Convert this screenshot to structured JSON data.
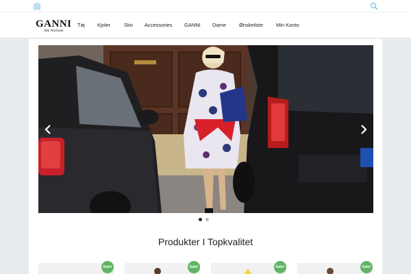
{
  "topbar": {
    "cart_icon": "shopping-bag-icon",
    "search_icon": "search-icon"
  },
  "header": {
    "logo": {
      "name": "GANNI",
      "sub": "Akk Narbads"
    },
    "nav": [
      {
        "label": "Tøj"
      },
      {
        "label": "Kjoler"
      },
      {
        "label": "Sko"
      },
      {
        "label": "Accessories"
      },
      {
        "label": "GANNI"
      },
      {
        "label": "Dame"
      },
      {
        "label": "Ønskeliste"
      },
      {
        "label": "Min Konto"
      }
    ]
  },
  "slider": {
    "prev_icon": "chevron-left-icon",
    "next_icon": "chevron-right-icon",
    "slide_count": 2,
    "active_slide": 1
  },
  "section": {
    "title": "Produkter I Topkvalitet"
  },
  "products": [
    {
      "badge": "Sale!"
    },
    {
      "badge": "Sale!"
    },
    {
      "badge": "Sale!"
    },
    {
      "badge": "Sale!"
    }
  ],
  "colors": {
    "sale_badge": "#60b565",
    "search_icon": "#7fc8e8",
    "page_bg": "#e8ebee"
  }
}
